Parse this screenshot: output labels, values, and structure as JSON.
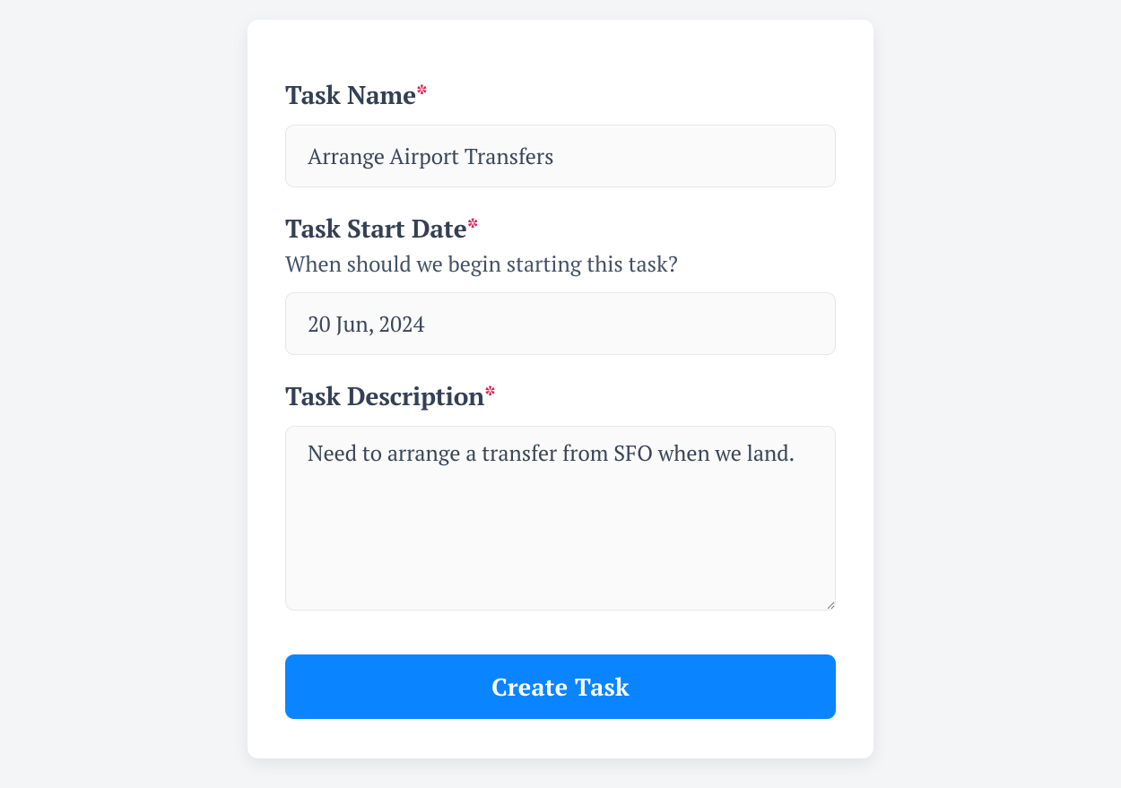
{
  "form": {
    "task_name": {
      "label": "Task Name",
      "value": "Arrange Airport Transfers"
    },
    "task_start_date": {
      "label": "Task Start Date",
      "help": "When should we begin starting this task?",
      "value": "20 Jun, 2024"
    },
    "task_description": {
      "label": "Task Description",
      "value": "Need to arrange a transfer from SFO when we land."
    },
    "required_marker": "*",
    "submit_label": "Create Task"
  }
}
